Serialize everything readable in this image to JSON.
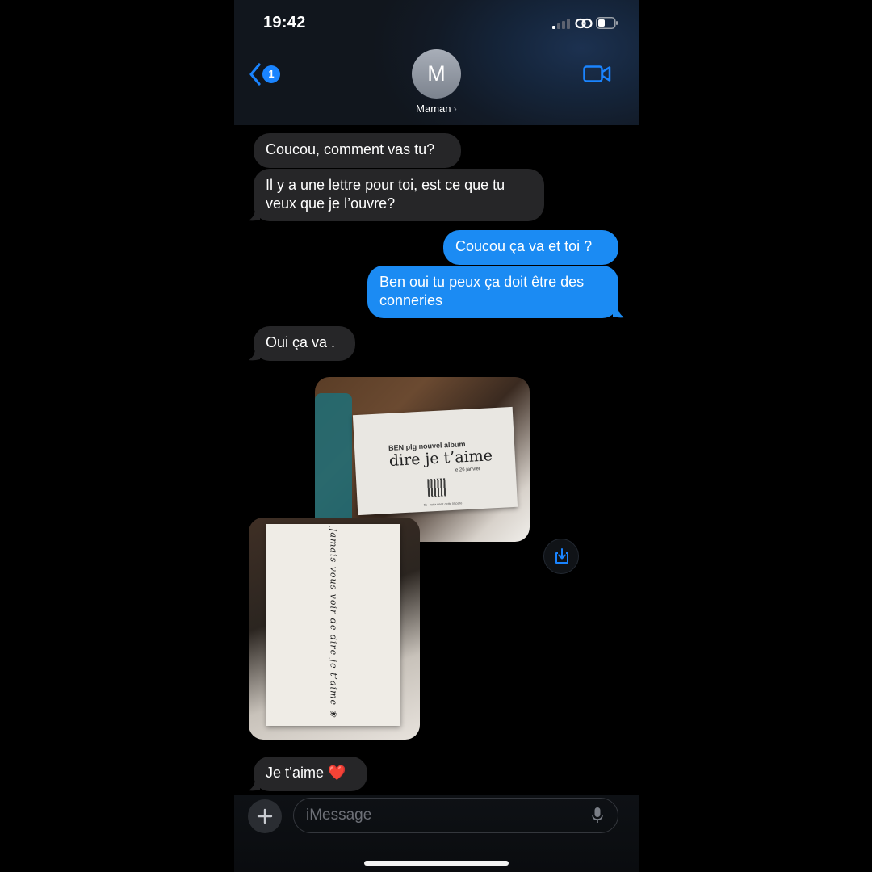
{
  "status_bar": {
    "time": "19:42"
  },
  "nav": {
    "back_badge": "1",
    "avatar_initial": "M",
    "contact_name": "Maman",
    "contact_chevron": "›"
  },
  "messages": [
    {
      "side": "received",
      "text": "Coucou, comment vas tu?"
    },
    {
      "side": "received",
      "text": "Il y a une lettre pour toi, est ce que tu veux que je l’ouvre?"
    },
    {
      "side": "sent",
      "text": "Coucou ça va et toi ?"
    },
    {
      "side": "sent",
      "text": "Ben oui tu peux ça doit être des conneries"
    },
    {
      "side": "received",
      "text": "Oui ça va ."
    },
    {
      "side": "received",
      "text": "Je t’aime ❤️"
    }
  ],
  "photos": {
    "card1_line1": "BEN plg nouvel album",
    "card1_line2": "dire je t’aime",
    "card1_line3": "le 26 janvier",
    "card1_line4": "flo · retournez cette lit pare",
    "card2_text": "Jamais vous voir de dire je t’aime ❀"
  },
  "composer": {
    "placeholder": "iMessage"
  },
  "icons": {
    "back": "chevron-left-icon",
    "video": "video-camera-icon",
    "save": "save-download-icon",
    "plus": "plus-icon",
    "mic": "microphone-icon"
  },
  "colors": {
    "accent": "#1a84ff",
    "sent_bubble": "#1b8bf3",
    "received_bubble": "#262628"
  }
}
